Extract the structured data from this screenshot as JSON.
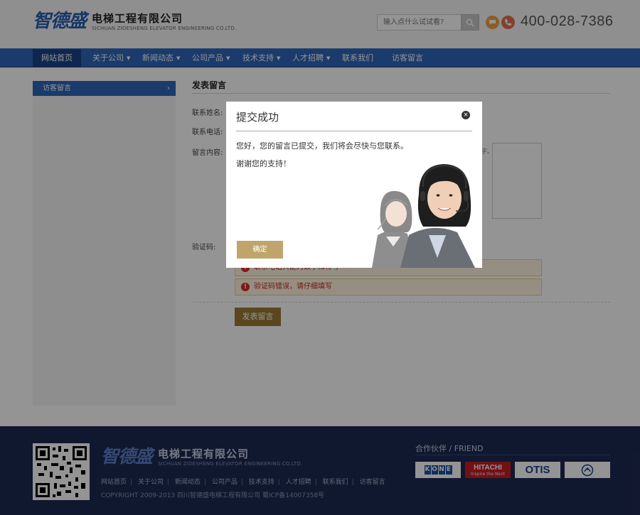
{
  "header": {
    "logo_mark": "智德盛",
    "logo_cn": "电梯工程有限公司",
    "logo_en": "SICHUAN ZIDESHENG ELEVATOR ENGINEERING CO.LTD.",
    "search_placeholder": "输入点什么试试看?",
    "phone": "400-028-7386"
  },
  "nav": {
    "items": [
      {
        "label": "网站首页"
      },
      {
        "label": "关于公司"
      },
      {
        "label": "新闻动态"
      },
      {
        "label": "公司产品"
      },
      {
        "label": "技术支持"
      },
      {
        "label": "人才招聘"
      },
      {
        "label": "联系我们"
      },
      {
        "label": "访客留言"
      }
    ]
  },
  "sidebar": {
    "item": "访客留言"
  },
  "form": {
    "title": "发表留言",
    "name_label": "联系姓名:",
    "tel_label": "联系电话:",
    "content_label": "留言内容:",
    "content_fragment": "字。",
    "captcha_label": "验证码:",
    "error1": "联系电话只能为数字和符号",
    "error2": "验证码错误，请仔细填写",
    "submit": "发表留言"
  },
  "footer": {
    "logo_mark": "智德盛",
    "logo_cn": "电梯工程有限公司",
    "logo_en": "SICHUAN ZIDESHENG ELEVATOR ENGINEERING CO.LTD.",
    "links": [
      "网站首页",
      "关于公司",
      "新闻动态",
      "公司产品",
      "技术支持",
      "人才招聘",
      "联系我们",
      "访客留言"
    ],
    "copyright": "COPYRIGHT 2009-2013 四川智德盛电梯工程有限公司  蜀ICP备14007358号",
    "partner_title": "合作伙伴 / FRIEND",
    "partners": [
      "KONE",
      "HITACHI",
      "OTIS",
      ""
    ],
    "hitachi_sub": "Inspire the Next"
  },
  "modal": {
    "title": "提交成功",
    "close": "×",
    "message1": "您好，您的留言已提交，我们将会尽快与您联系。",
    "message2": "谢谢您的支持！",
    "ok": "确定"
  },
  "colors": {
    "nav": "#2e66b8",
    "nav_active": "#1b4488",
    "footer": "#1d2a52",
    "ok_button": "#bfa56b",
    "error_text": "#d21f1f"
  }
}
